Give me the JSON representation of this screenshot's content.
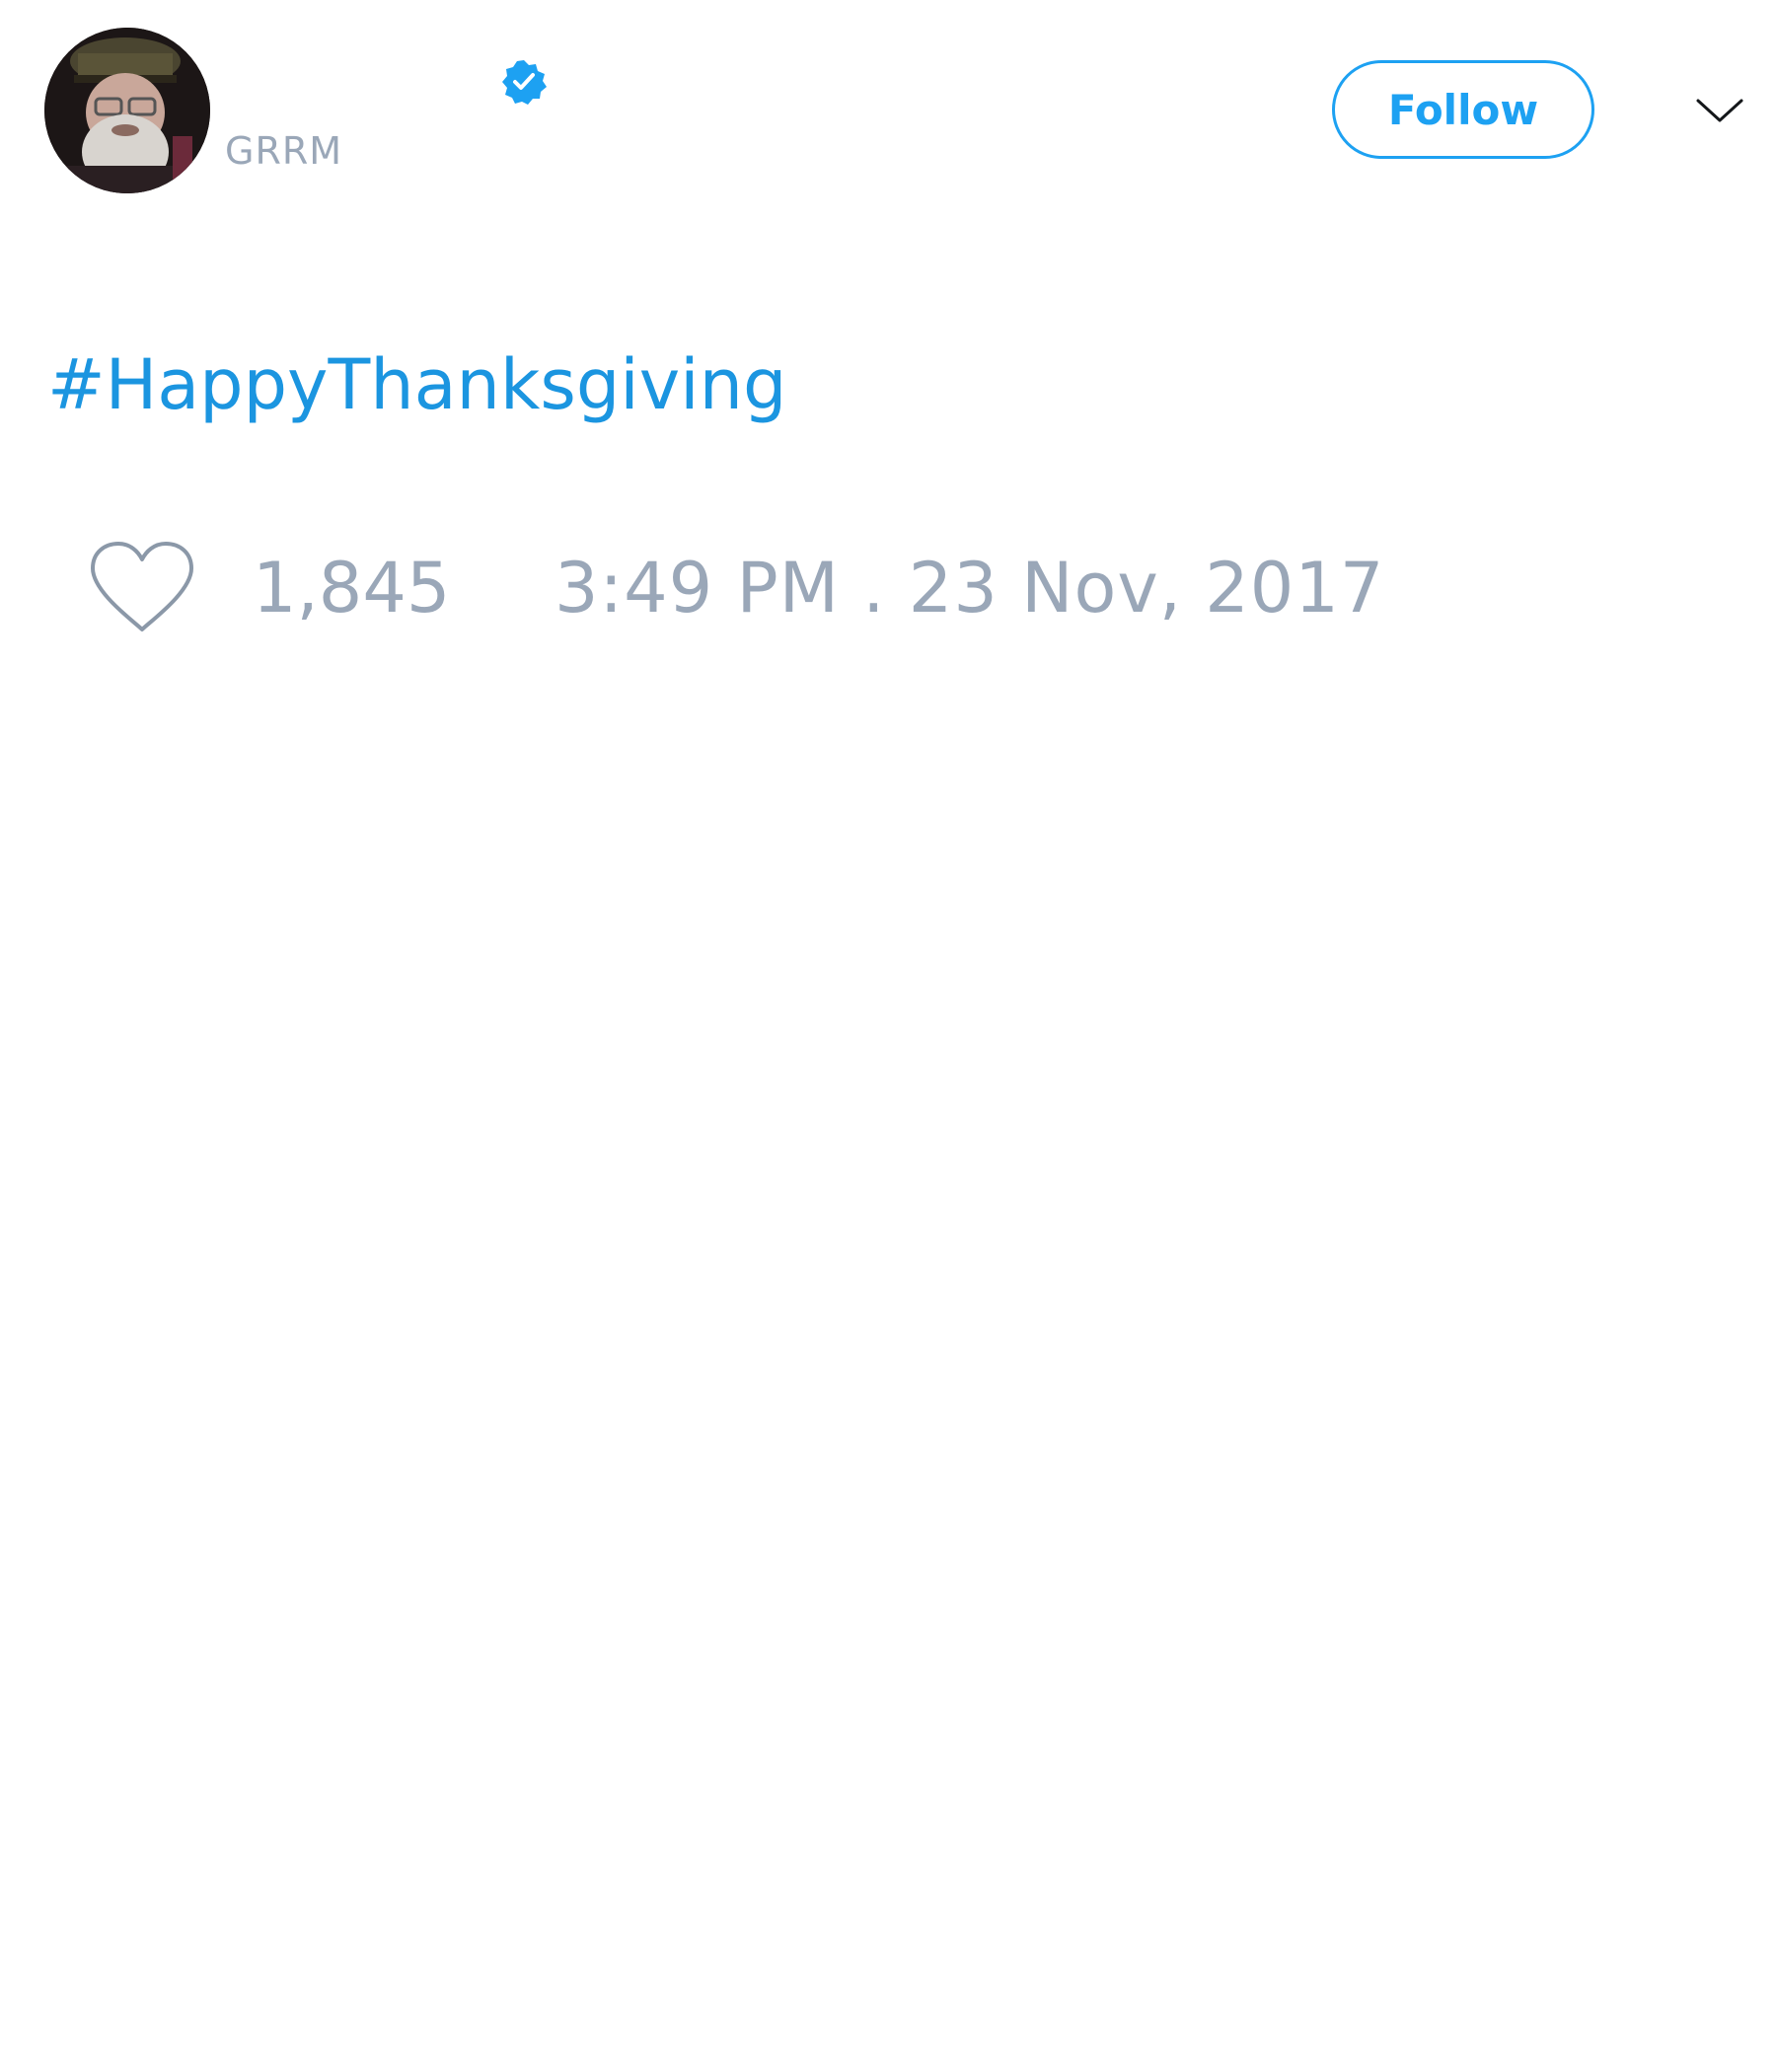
{
  "author": {
    "display_name": "",
    "handle": "GRRM",
    "verified": true,
    "avatar_icon": "avatar-photo"
  },
  "header": {
    "follow_label": "Follow",
    "menu_icon": "chevron-down-icon"
  },
  "tweet": {
    "text": "#HappyThanksgiving"
  },
  "actions": {
    "like_icon": "heart-outline-icon",
    "like_count": "1,845",
    "timestamp": "3:49 PM . 23 Nov, 2017"
  },
  "colors": {
    "accent": "#1da1f2",
    "link": "#1b95e0",
    "muted": "#9aa7b8",
    "background": "#ffffff"
  }
}
